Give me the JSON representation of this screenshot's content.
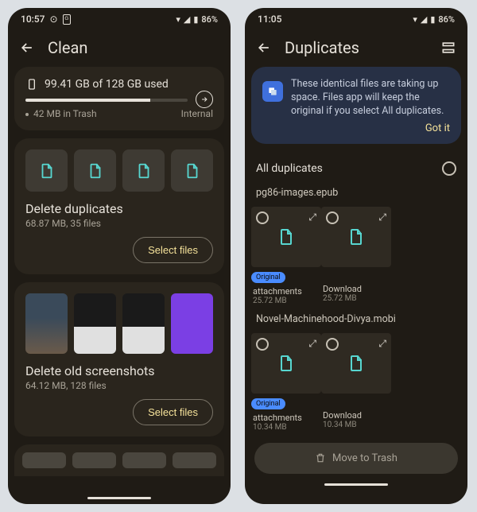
{
  "left": {
    "time": "10:57",
    "battery": "86%",
    "title": "Clean",
    "storage": {
      "summary": "99.41 GB of 128 GB used",
      "trash": "42 MB in Trash",
      "location": "Internal",
      "fill_pct": 77
    },
    "duplicates_card": {
      "title": "Delete duplicates",
      "subtitle": "68.87 MB, 35 files",
      "action": "Select files"
    },
    "screenshots_card": {
      "title": "Delete old screenshots",
      "subtitle": "64.12 MB, 128 files",
      "action": "Select files"
    }
  },
  "right": {
    "time": "11:05",
    "battery": "86%",
    "title": "Duplicates",
    "banner": {
      "text": "These identical files are taking up space. Files app will keep the original if you select All duplicates.",
      "action": "Got it"
    },
    "all_label": "All duplicates",
    "groups": [
      {
        "name": "pg86-images.epub",
        "items": [
          {
            "caption": "attachments",
            "size": "25.72 MB",
            "original": true
          },
          {
            "caption": "Download",
            "size": "25.72 MB",
            "original": false
          }
        ]
      },
      {
        "name": "Novel-Machinehood-Divya.mobi",
        "items": [
          {
            "caption": "attachments",
            "size": "10.34 MB",
            "original": true
          },
          {
            "caption": "Download",
            "size": "10.34 MB",
            "original": false
          }
        ]
      }
    ],
    "trash_button": "Move to Trash"
  }
}
